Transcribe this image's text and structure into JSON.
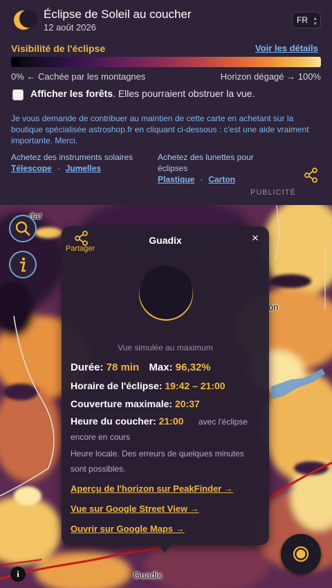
{
  "header": {
    "title": "Éclipse de Soleil au coucher",
    "date": "12 août 2026",
    "language": "FR"
  },
  "visibility": {
    "label": "Visibilité de l'éclipse",
    "details_link": "Voir les détails",
    "legend_left": "0% ← Cachée par les montagnes",
    "legend_right": "Horizon dégagé → 100%"
  },
  "forests": {
    "label_bold": "Afficher les forêts",
    "label_rest": ". Elles pourraient obstruer la vue.",
    "checked": false
  },
  "support": {
    "text": "Je vous demande de contribuer au maintien de cette carte en achetant sur la boutique spécialisée astroshop.fr en cliquant ci-dessous : c'est une aide vraiment importante. Merci."
  },
  "shop": {
    "instruments_label": "Achetez des instruments solaires",
    "telescope": "Télescope",
    "binoculars": "Jumelles",
    "glasses_label": "Achetez des lunettes pour éclipses",
    "plastic": "Plastique",
    "cardboard": "Carton",
    "ad_label": "PUBLICITÉ"
  },
  "map": {
    "labels": [
      "dar",
      "ón",
      "Guadix"
    ]
  },
  "popup": {
    "share_label": "Partager",
    "title": "Guadix",
    "close": "×",
    "simulated_view": "Vue simulée au maximum",
    "duration_label": "Durée:",
    "duration_value": "78 min",
    "max_label": "Max:",
    "max_value": "96,32%",
    "schedule_label": "Horaire de l'éclipse:",
    "schedule_value": "19:42 – 21:00",
    "coverage_label": "Couverture maximale:",
    "coverage_value": "20:37",
    "sunset_label": "Heure du coucher:",
    "sunset_value": "21:00",
    "sunset_note": "avec l'éclipse encore en cours",
    "local_note": "Heure locale. Des erreurs de quelques minutes sont possibles.",
    "peakfinder_link": "Aperçu de l'horizon sur PeakFinder →",
    "streetview_link": "Vue sur Google Street View →",
    "maps_link": "Ouvrir sur Google Maps →"
  },
  "colors": {
    "accent": "#f2b642",
    "link": "#7fb6f2",
    "panel": "#2e2338"
  },
  "icons": {
    "logo": "moon-eclipse-icon",
    "share": "share-icon",
    "search": "search-icon",
    "info": "info-icon",
    "locate": "locate-sun-icon",
    "close": "close-icon"
  }
}
